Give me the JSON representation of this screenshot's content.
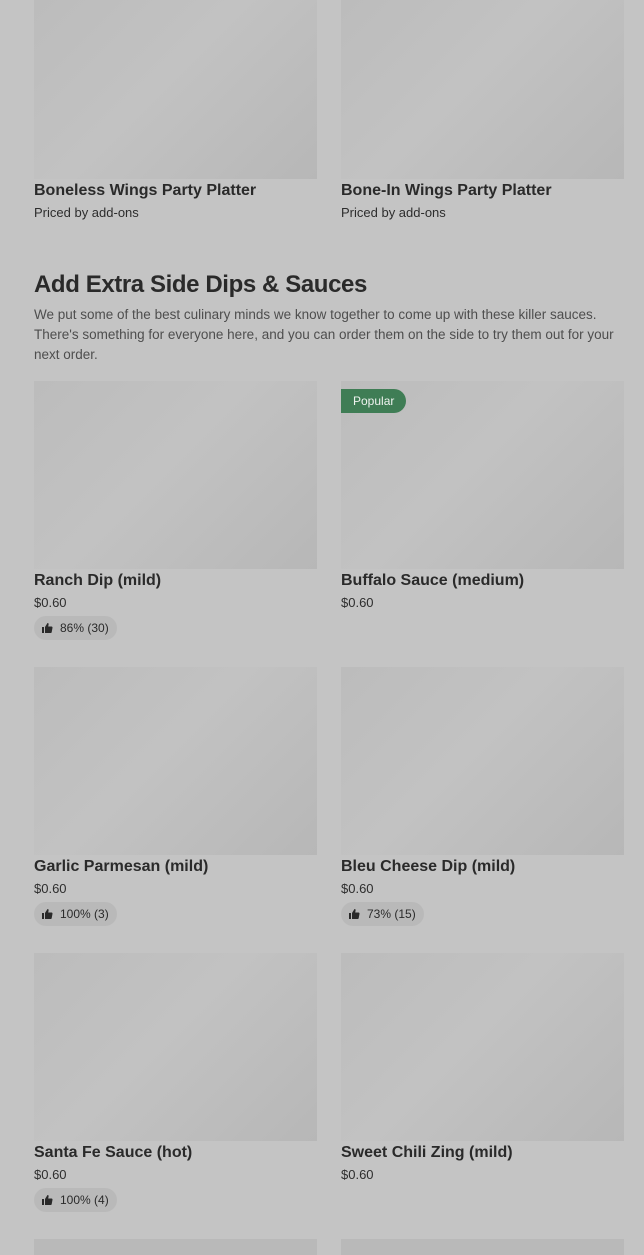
{
  "platters": [
    {
      "title": "Boneless Wings Party Platter",
      "price": "Priced by add-ons"
    },
    {
      "title": "Bone-In Wings Party Platter",
      "price": "Priced by add-ons"
    }
  ],
  "section": {
    "title": "Add Extra Side Dips & Sauces",
    "description": "We put some of the best culinary minds we know together to come up with these killer sauces. There's something for everyone here, and you can order them on the side to try them out for your next order."
  },
  "items": [
    {
      "title": "Ranch Dip (mild)",
      "price": "$0.60",
      "rating": "86% (30)",
      "badge": ""
    },
    {
      "title": "Buffalo Sauce (medium)",
      "price": "$0.60",
      "rating": "",
      "badge": "Popular"
    },
    {
      "title": "Garlic Parmesan (mild)",
      "price": "$0.60",
      "rating": "100% (3)",
      "badge": ""
    },
    {
      "title": "Bleu Cheese Dip (mild)",
      "price": "$0.60",
      "rating": "73% (15)",
      "badge": ""
    },
    {
      "title": "Santa Fe Sauce (hot)",
      "price": "$0.60",
      "rating": "100% (4)",
      "badge": ""
    },
    {
      "title": "Sweet Chili Zing (mild)",
      "price": "$0.60",
      "rating": "",
      "badge": ""
    }
  ],
  "icons": {
    "rating": "thumbs-up-icon"
  },
  "colors": {
    "badge": "#3f7d55",
    "background": "#c4c4c4"
  }
}
